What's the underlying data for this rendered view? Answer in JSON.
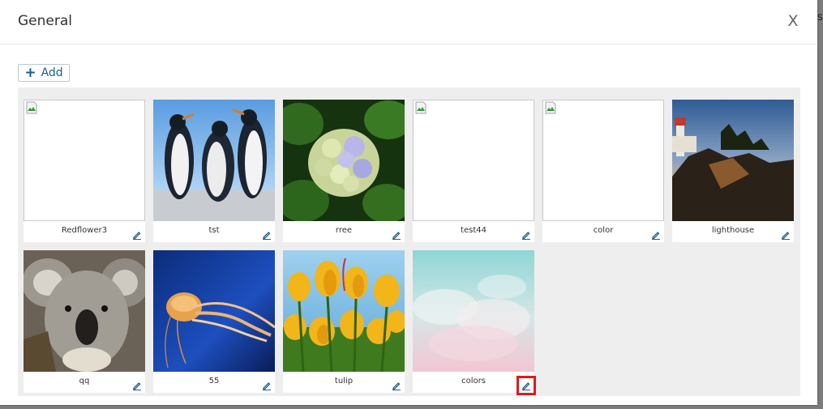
{
  "dialog": {
    "title": "General",
    "close_label": "X",
    "add_label": "Add",
    "peek_text": "s"
  },
  "images": [
    {
      "label": "Redflower3",
      "broken": true
    },
    {
      "label": "tst",
      "broken": false,
      "subject": "penguins"
    },
    {
      "label": "rree",
      "broken": false,
      "subject": "hydrangea"
    },
    {
      "label": "test44",
      "broken": true
    },
    {
      "label": "color",
      "broken": true
    },
    {
      "label": "lighthouse",
      "broken": false,
      "subject": "lighthouse"
    },
    {
      "label": "qq",
      "broken": false,
      "subject": "koala"
    },
    {
      "label": "55",
      "broken": false,
      "subject": "jellyfish"
    },
    {
      "label": "tulip",
      "broken": false,
      "subject": "tulips"
    },
    {
      "label": "colors",
      "broken": false,
      "subject": "pastel-clouds",
      "highlighted": true
    }
  ],
  "colors": {
    "accent": "#1c5f8f",
    "highlight": "#e0191b"
  }
}
